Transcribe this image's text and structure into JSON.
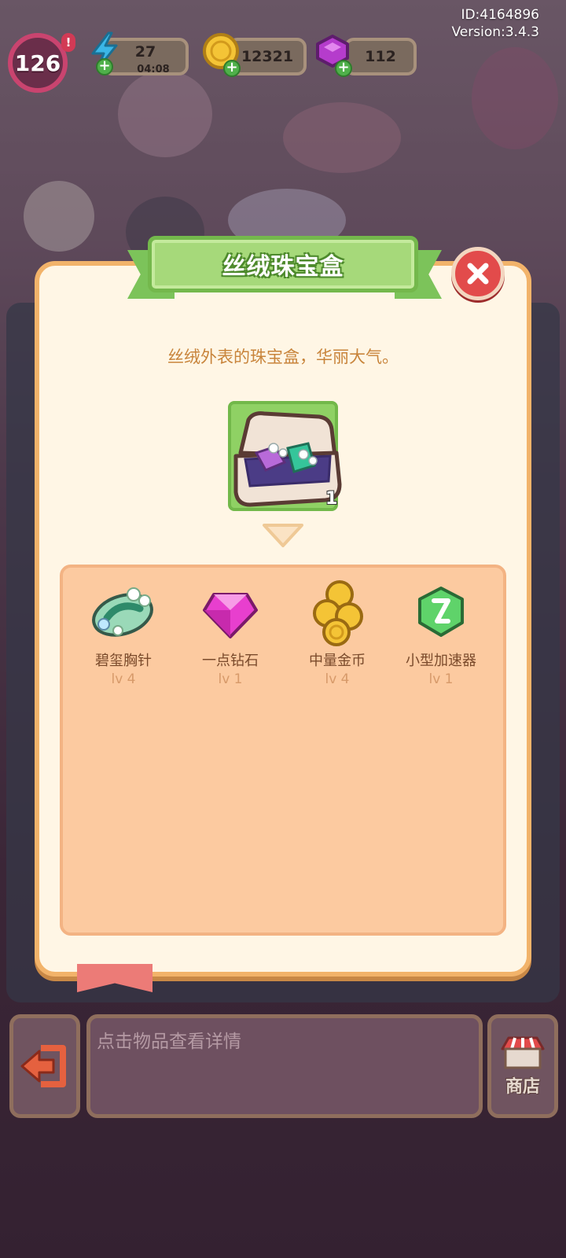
{
  "hud": {
    "id": "ID:4164896",
    "version": "Version:3.4.3",
    "level": "126",
    "level_alert": "!",
    "energy": "27",
    "energy_timer": "04:08",
    "coins": "12321",
    "gems": "112"
  },
  "dialog": {
    "title": "丝绒珠宝盒",
    "description": "丝绒外表的珠宝盒，华丽大气。",
    "item_count": "1",
    "rewards": [
      {
        "name": "碧玺胸针",
        "level": "lv 4",
        "icon": "emerald-brooch-icon"
      },
      {
        "name": "一点钻石",
        "level": "lv 1",
        "icon": "pink-diamond-icon"
      },
      {
        "name": "中量金币",
        "level": "lv 4",
        "icon": "gold-coins-stack-icon"
      },
      {
        "name": "小型加速器",
        "level": "lv 1",
        "icon": "hourglass-accelerator-icon"
      }
    ]
  },
  "bottom_bar": {
    "info_placeholder": "点击物品查看详情",
    "shop_label": "商店"
  },
  "colors": {
    "title_green": "#a6d97a",
    "dialog_bg": "#fff6e5",
    "rewards_bg": "#fccaa0",
    "close_red": "#e24b4b",
    "description_text": "#c8843b"
  }
}
